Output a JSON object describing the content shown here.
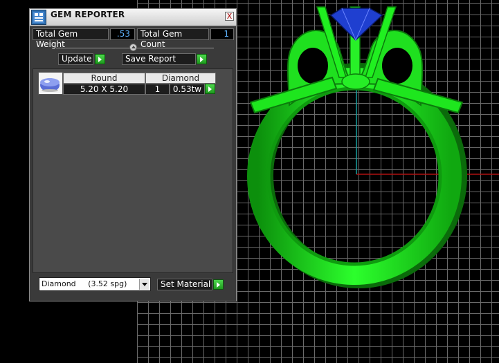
{
  "panel": {
    "title": "GEM REPORTER",
    "close_label": "X",
    "total_weight_label": "Total Gem Weight",
    "total_weight_value": ".53",
    "total_count_label": "Total Gem Count",
    "total_count_value": "1",
    "update_label": "Update",
    "save_report_label": "Save Report",
    "table": {
      "headers": [
        "Round",
        "Diamond"
      ],
      "row": {
        "size": "5.20 X 5.20",
        "count": "1",
        "weight": "0.53tw"
      }
    },
    "material_select": "Diamond     (3.52 spg)",
    "set_material_label": "Set Material"
  },
  "icons": [
    "app-icon",
    "close-icon",
    "slider-knob-icon",
    "play-arrow-icon",
    "gem-icon",
    "chevron-down-icon"
  ],
  "colors": {
    "ring": "#1aff1a",
    "gem": "#1f3fd0",
    "axis_x": "#b01010",
    "axis_y": "#1aa0a0",
    "value_text": "#5fb4ff"
  }
}
